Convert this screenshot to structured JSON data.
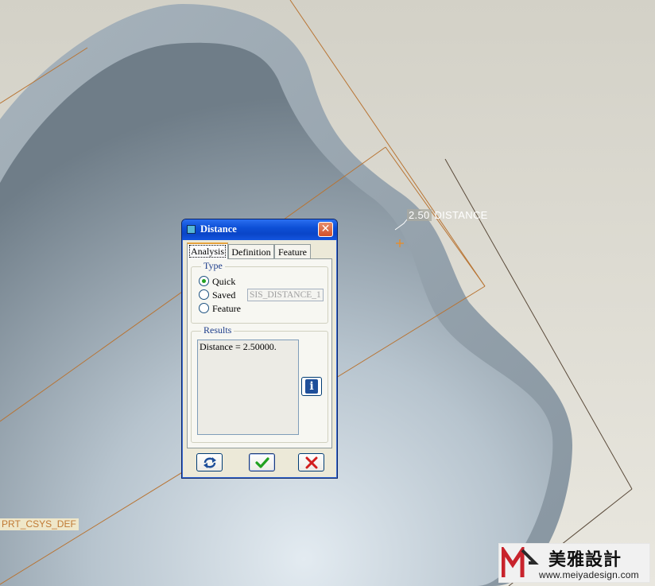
{
  "viewport": {
    "distance_annotation": "2.50",
    "distance_annotation_label": "DISTANCE",
    "csys_label": "PRT_CSYS_DEF"
  },
  "dialog": {
    "title": "Distance",
    "tabs": [
      {
        "label": "Analysis",
        "active": true
      },
      {
        "label": "Definition",
        "active": false
      },
      {
        "label": "Feature",
        "active": false
      }
    ],
    "type_group": {
      "label": "Type",
      "options": [
        {
          "label": "Quick",
          "selected": true
        },
        {
          "label": "Saved",
          "selected": false
        },
        {
          "label": "Feature",
          "selected": false
        }
      ],
      "saved_name": "SIS_DISTANCE_1"
    },
    "results_group": {
      "label": "Results",
      "text": "Distance = 2.50000."
    },
    "icons": {
      "info": "info-icon",
      "regen": "repeat-icon",
      "ok": "checkmark-icon",
      "cancel": "x-icon"
    },
    "info_glyph": "i"
  },
  "watermark": {
    "brand": "美雅設計",
    "url": "www.meiyadesign.com"
  },
  "colors": {
    "part_surface": "#9aa8b2",
    "datum_line": "#b87433",
    "title_bar": "#0a45c8",
    "ok_green": "#21a121",
    "cancel_red": "#d21e1e"
  }
}
